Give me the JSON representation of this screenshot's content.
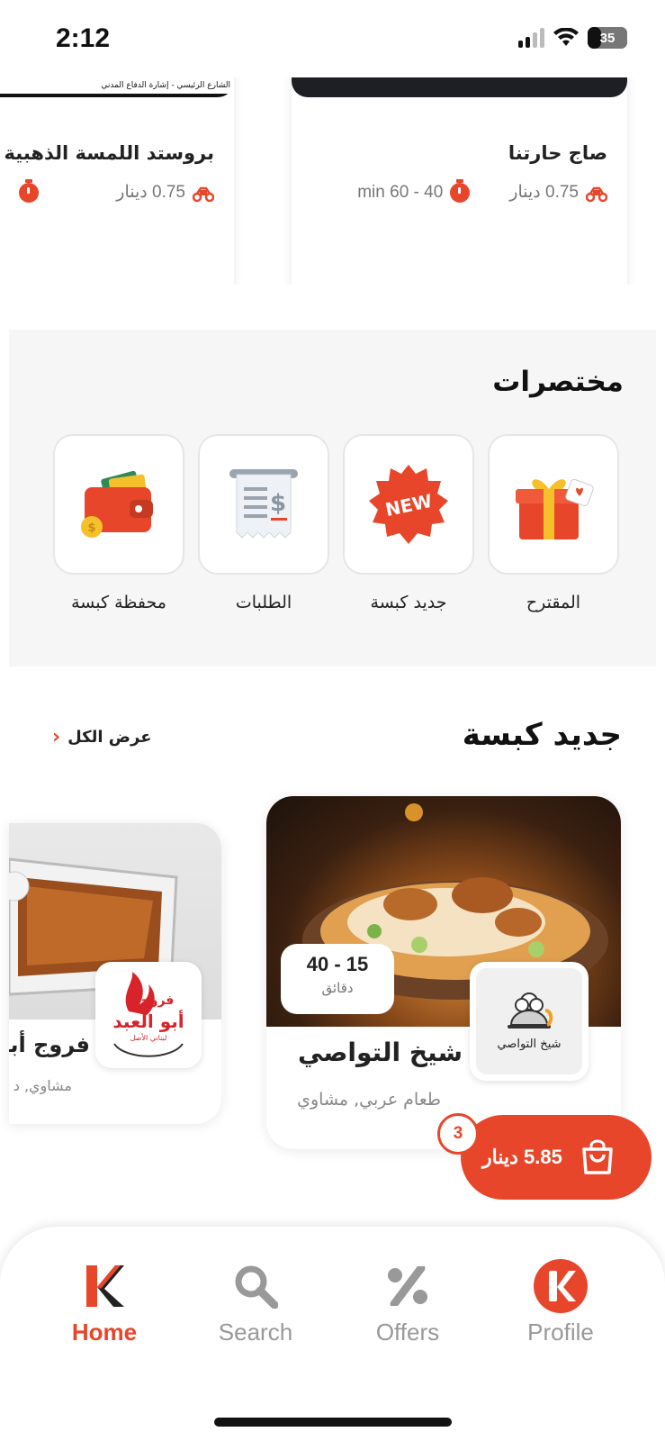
{
  "status": {
    "time": "2:12",
    "battery": "35"
  },
  "top_restaurants": [
    {
      "name": "صاج حارتنا",
      "delivery_fee": "0.75 دينار",
      "eta": "min 60 - 40"
    },
    {
      "name": "بروستد اللمسة الذهبية",
      "delivery_fee": "0.75 دينار",
      "banner": "الشارع الرئيسي - إشارة الدفاع المدني"
    }
  ],
  "shortcuts": {
    "title": "مختصرات",
    "items": [
      {
        "label": "المقترح",
        "icon": "gift-icon"
      },
      {
        "label": "جديد كبسة",
        "icon": "new-badge-icon",
        "badge_text": "NEW"
      },
      {
        "label": "الطلبات",
        "icon": "receipt-icon"
      },
      {
        "label": "محفظة كبسة",
        "icon": "wallet-icon"
      }
    ]
  },
  "new_section": {
    "title": "جديد كبسة",
    "view_all": "عرض الكل",
    "cards": [
      {
        "name": "شيخ التواصي",
        "category": "طعام عربي, مشاوي",
        "eta_range": "40 - 15",
        "eta_unit": "دقائق",
        "logo_text": "شيخ التواصي"
      },
      {
        "name": "فروج أبو العبد",
        "category": "مشاوي, د",
        "logo_line1": "فروج",
        "logo_line2": "أبو العبد",
        "logo_line3": "لبناني الأصل"
      }
    ]
  },
  "cart": {
    "count": "3",
    "amount": "5.85 دينار"
  },
  "nav": {
    "items": [
      {
        "label": "Home",
        "active": true
      },
      {
        "label": "Search",
        "active": false
      },
      {
        "label": "Offers",
        "active": false
      },
      {
        "label": "Profile",
        "active": false
      }
    ]
  },
  "colors": {
    "accent": "#e8462a",
    "nav_inactive": "#999999"
  }
}
